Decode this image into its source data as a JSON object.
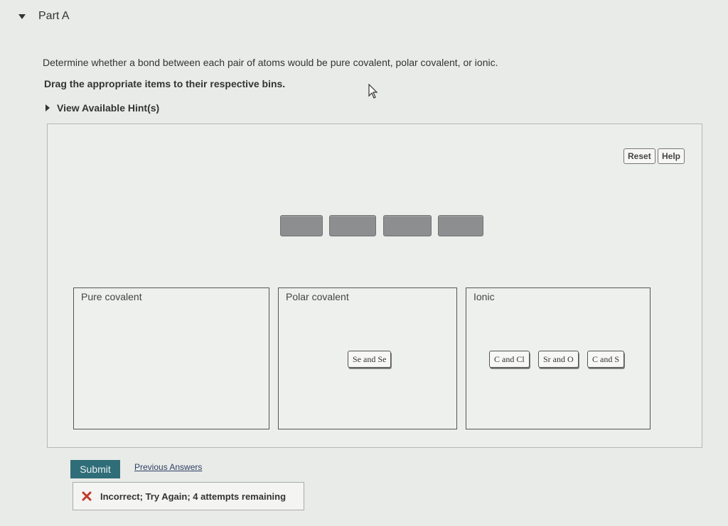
{
  "part": {
    "title": "Part A"
  },
  "question": {
    "text": "Determine whether a bond between each pair of atoms would be pure covalent, polar covalent, or ionic.",
    "instruction": "Drag the appropriate items to their respective bins."
  },
  "hint": {
    "label": "View Available Hint(s)"
  },
  "toolbar": {
    "reset_label": "Reset",
    "help_label": "Help"
  },
  "bins": [
    {
      "label": "Pure covalent",
      "items": []
    },
    {
      "label": "Polar covalent",
      "items": [
        "Se and Se"
      ]
    },
    {
      "label": "Ionic",
      "items": [
        "C and Cl",
        "Sr and O",
        "C and S"
      ]
    }
  ],
  "actions": {
    "submit_label": "Submit",
    "previous_answers_label": "Previous Answers"
  },
  "feedback": {
    "text": "Incorrect; Try Again; 4 attempts remaining"
  },
  "colors": {
    "submit_bg": "#2f6d78",
    "error_red": "#c0392b"
  }
}
